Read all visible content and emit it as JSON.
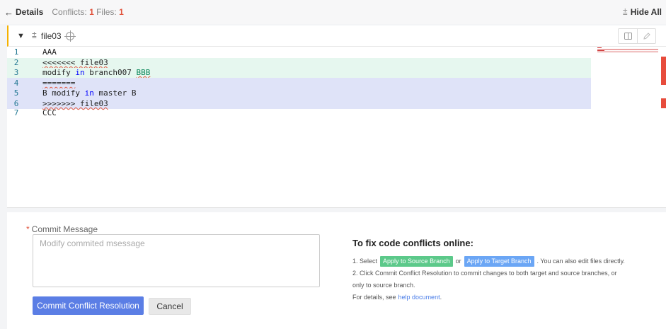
{
  "topbar": {
    "back_label": "Details",
    "conflicts_label": "Conflicts:",
    "conflicts_count": "1",
    "files_label": "Files:",
    "files_count": "1",
    "hide_all_label": "Hide All"
  },
  "file": {
    "name": "file03"
  },
  "editor": {
    "lines": [
      {
        "num": "1",
        "text": "AAA"
      },
      {
        "num": "2",
        "text": "<<<<<<< file03"
      },
      {
        "num": "3",
        "pre": "modify ",
        "kw": "in",
        "post": " branch007 ",
        "sq": "BBB"
      },
      {
        "num": "4",
        "text": "======="
      },
      {
        "num": "5",
        "pre": "B modify ",
        "kw": "in",
        "post": " master B"
      },
      {
        "num": "6",
        "text": ">>>>>>> file03"
      },
      {
        "num": "7",
        "text": "CCC"
      }
    ]
  },
  "commit": {
    "label": "Commit Message",
    "required_mark": "*",
    "placeholder": "Modify commited msessage",
    "submit_label": "Commit Conflict Resolution",
    "cancel_label": "Cancel"
  },
  "help": {
    "title": "To fix code conflicts online:",
    "step1_prefix": "1. Select",
    "apply_source_label": "Apply to Source Branch",
    "or_text": "or",
    "apply_target_label": "Apply to Target Branch",
    "step1_suffix": ". You can also edit files directly.",
    "step2_line1": "2. Click Commit Conflict Resolution to commit changes to both target and source branches, or",
    "step2_line2": "only to source branch.",
    "details_prefix": "For details, see",
    "help_link": "help document",
    "details_suffix": "."
  },
  "colors": {
    "accent": "#5b7ee5",
    "conflict_red": "#e1543d",
    "incoming_bg": "#e6f7ef",
    "current_bg": "#dfe3f8"
  }
}
